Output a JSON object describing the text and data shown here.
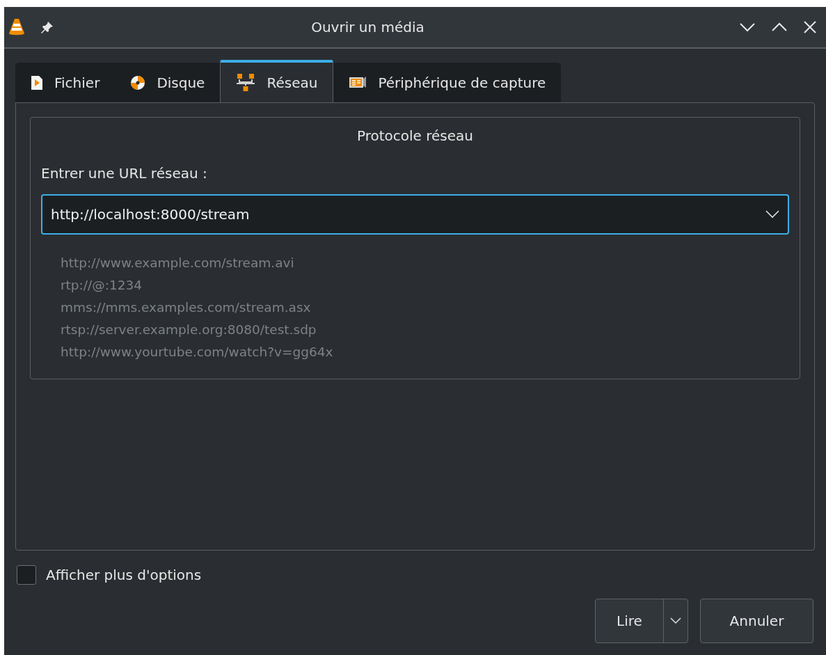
{
  "window": {
    "title": "Ouvrir un média"
  },
  "tabs": [
    {
      "label": "Fichier",
      "kind": "file",
      "selected": false
    },
    {
      "label": "Disque",
      "kind": "disc",
      "selected": false
    },
    {
      "label": "Réseau",
      "kind": "network",
      "selected": true
    },
    {
      "label": "Périphérique de capture",
      "kind": "capture",
      "selected": false
    }
  ],
  "group": {
    "title": "Protocole réseau",
    "url_label": "Entrer une URL réseau :",
    "url_value": "http://localhost:8000/stream",
    "examples": [
      "http://www.example.com/stream.avi",
      "rtp://@:1234",
      "mms://mms.examples.com/stream.asx",
      "rtsp://server.example.org:8080/test.sdp",
      "http://www.yourtube.com/watch?v=gg64x"
    ]
  },
  "more_options": {
    "label": "Afficher plus d'options",
    "checked": false
  },
  "buttons": {
    "play": "Lire",
    "cancel": "Annuler"
  }
}
